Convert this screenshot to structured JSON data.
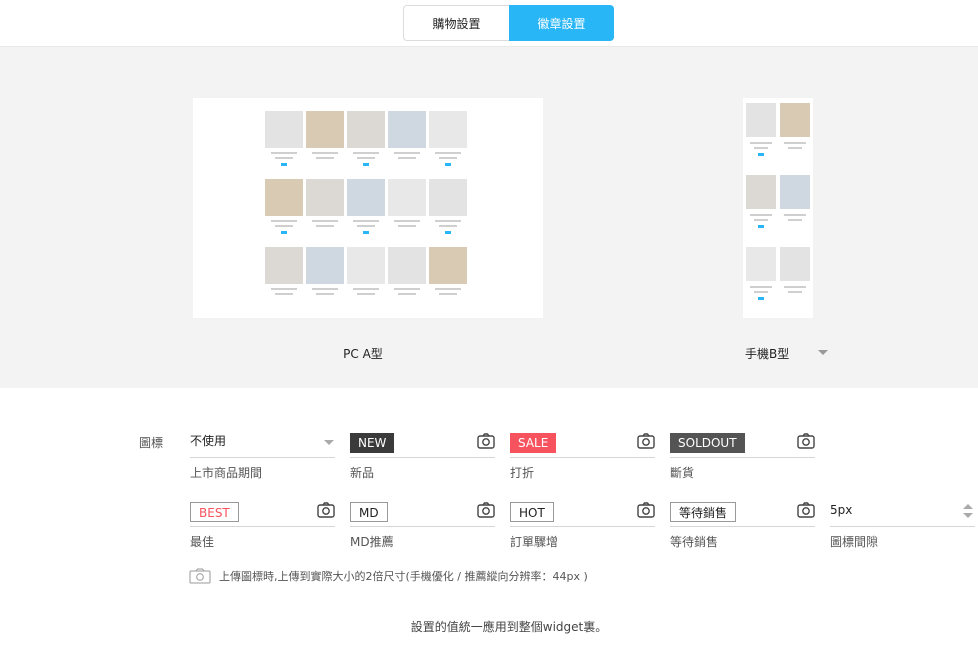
{
  "tabs": [
    {
      "label": "購物設置",
      "active": false
    },
    {
      "label": "徽章設置",
      "active": true
    }
  ],
  "preview": {
    "pc_label": "PC A型",
    "mobile_label": "手機B型"
  },
  "settings": {
    "section_label": "圖標",
    "period": {
      "value": "不使用",
      "label": "上市商品期間"
    },
    "badges": [
      {
        "text": "NEW",
        "label": "新品"
      },
      {
        "text": "SALE",
        "label": "打折"
      },
      {
        "text": "SOLDOUT",
        "label": "斷貨"
      },
      {
        "text": "BEST",
        "label": "最佳"
      },
      {
        "text": "MD",
        "label": "MD推薦"
      },
      {
        "text": "HOT",
        "label": "訂單驟增"
      },
      {
        "text": "等待銷售",
        "label": "等待銷售"
      }
    ],
    "spacing": {
      "value": "5px",
      "label": "圖標間隙"
    },
    "upload_note": "上傳圖標時,上傳到實際大小的2倍尺寸(手機優化 / 推薦縱向分辨率：44px )"
  },
  "footer_message": "設置的值統一應用到整個widget裏。",
  "colors": {
    "accent": "#29b6f6",
    "sale": "#f6535f",
    "new": "#3a3a3a",
    "soldout": "#545454"
  },
  "icons": [
    "camera-icon",
    "chevron-down-icon",
    "spinner-icon"
  ]
}
